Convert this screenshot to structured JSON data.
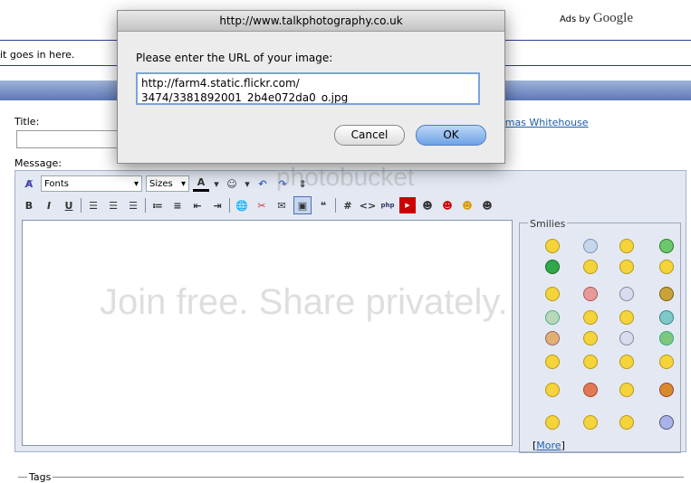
{
  "page": {
    "ads_prefix": "Ads by",
    "ads_brand": "Google",
    "goes_text": "it goes in here.",
    "title_label": "Title:",
    "author_link": "omas Whitehouse",
    "message_label": "Message:",
    "tags_label": "Tags"
  },
  "toolbar": {
    "fonts": "Fonts",
    "sizes": "Sizes",
    "bold": "B",
    "italic": "I",
    "underline": "U",
    "code": "#",
    "html": "<>"
  },
  "smilies": {
    "legend": "Smilies",
    "more_open": "[",
    "more_label": "More",
    "more_close": "]"
  },
  "watermark": {
    "top": "photobucket",
    "bottom": "Join free. Share privately."
  },
  "dialog": {
    "title": "http://www.talkphotography.co.uk",
    "prompt": "Please enter the URL of your image:",
    "url_value": "http://farm4.static.flickr.com/\n3474/3381892001_2b4e072da0_o.jpg",
    "cancel_label": "Cancel",
    "ok_label": "OK"
  },
  "colors": {
    "accent": "#5c79b8",
    "link": "#1f5fa8",
    "ok_button": "#6ea2e6"
  }
}
